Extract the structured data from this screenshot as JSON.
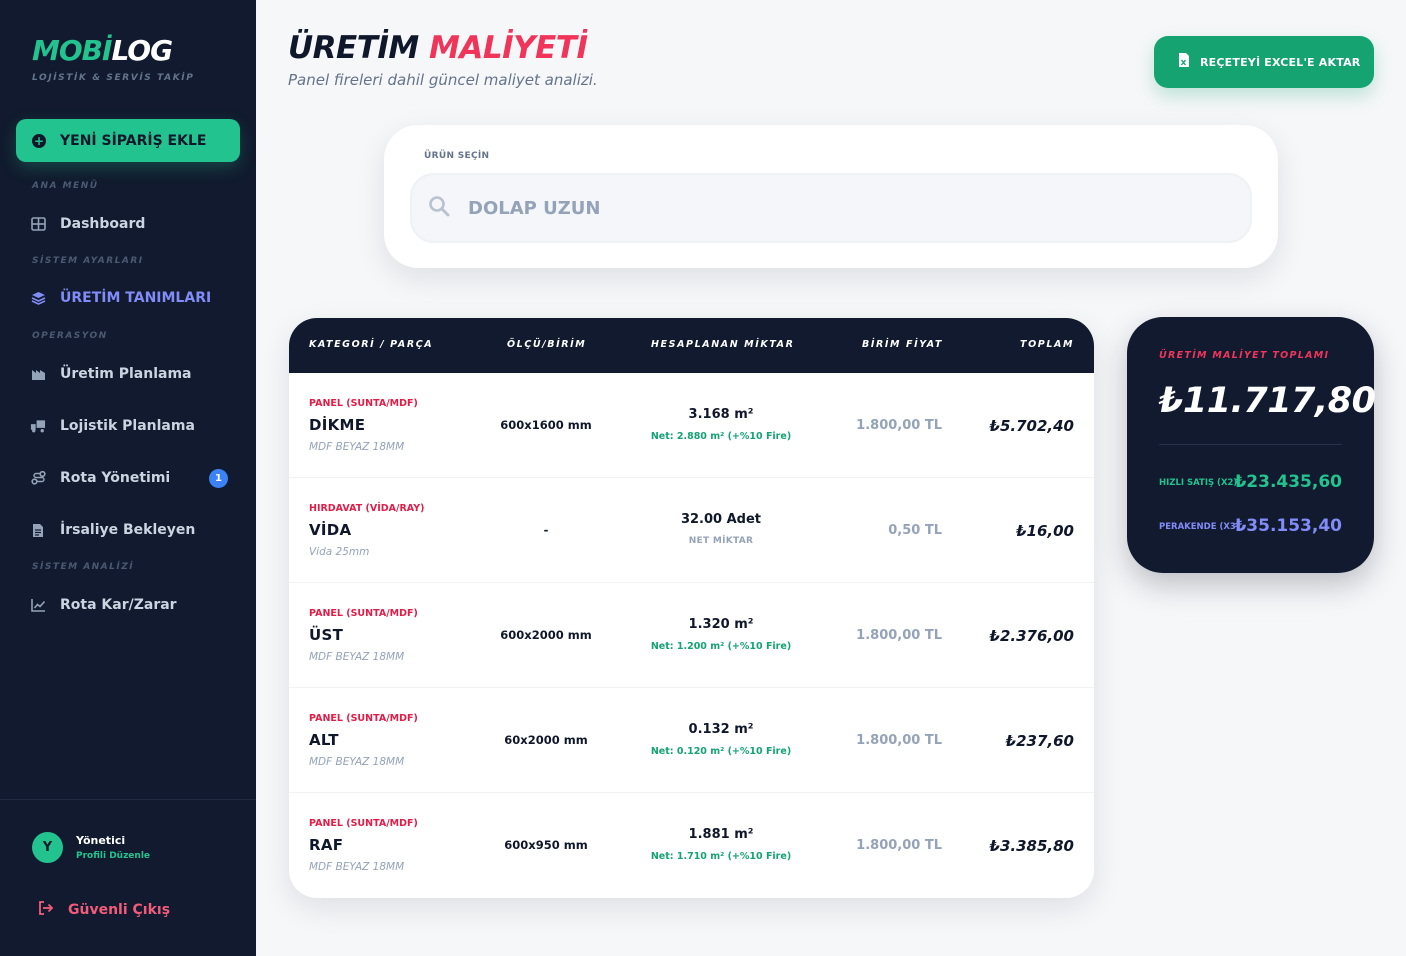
{
  "brand": {
    "part1": "MOBİ",
    "part2": "LOG",
    "tagline": "LOJİSTİK & SERVİS TAKİP"
  },
  "sidebar": {
    "new_order_label": "YENİ SİPARİŞ EKLE",
    "sections": {
      "main": "ANA MENÜ",
      "system": "SİSTEM AYARLARI",
      "ops": "OPERASYON",
      "analysis": "SİSTEM ANALİZİ"
    },
    "items": [
      {
        "label": "Dashboard",
        "icon": "grid-icon"
      },
      {
        "label": "ÜRETİM TANIMLARI",
        "icon": "layers-icon",
        "active": true
      },
      {
        "label": "Üretim Planlama",
        "icon": "factory-icon"
      },
      {
        "label": "Lojistik Planlama",
        "icon": "truck-icon"
      },
      {
        "label": "Rota Yönetimi",
        "icon": "route-icon",
        "badge": "1"
      },
      {
        "label": "İrsaliye Bekleyen",
        "icon": "document-icon"
      },
      {
        "label": "Rota Kar/Zarar",
        "icon": "chart-line-icon"
      }
    ],
    "user": {
      "initial": "Y",
      "name": "Yönetici",
      "edit_label": "Profili Düzenle"
    },
    "logout_label": "Güvenli Çıkış"
  },
  "header": {
    "title_part1": "ÜRETİM",
    "title_part2": "MALİYETİ",
    "subtitle": "Panel fireleri dahil güncel maliyet analizi.",
    "export_label": "REÇETEYİ EXCEL'E AKTAR"
  },
  "search": {
    "label": "ÜRÜN SEÇİN",
    "value": "DOLAP UZUN"
  },
  "table": {
    "headers": [
      "KATEGORİ / PARÇA",
      "ÖLÇÜ/BİRİM",
      "HESAPLANAN MİKTAR",
      "BİRİM FİYAT",
      "TOPLAM"
    ],
    "rows": [
      {
        "category": "PANEL (SUNTA/MDF)",
        "part": "DİKME",
        "spec": "MDF BEYAZ 18MM",
        "size": "600x1600 mm",
        "qty": "3.168 m²",
        "note": "Net: 2.880 m² (+%10 Fire)",
        "price": "1.800,00 TL",
        "total": "₺5.702,40"
      },
      {
        "category": "HIRDAVAT (VİDA/RAY)",
        "part": "VİDA",
        "spec": "Vida 25mm",
        "size": "-",
        "qty": "32.00 Adet",
        "note": "NET MİKTAR",
        "price": "0,50 TL",
        "total": "₺16,00"
      },
      {
        "category": "PANEL (SUNTA/MDF)",
        "part": "ÜST",
        "spec": "MDF BEYAZ 18MM",
        "size": "600x2000 mm",
        "qty": "1.320 m²",
        "note": "Net: 1.200 m² (+%10 Fire)",
        "price": "1.800,00 TL",
        "total": "₺2.376,00"
      },
      {
        "category": "PANEL (SUNTA/MDF)",
        "part": "ALT",
        "spec": "MDF BEYAZ 18MM",
        "size": "60x2000 mm",
        "qty": "0.132 m²",
        "note": "Net: 0.120 m² (+%10 Fire)",
        "price": "1.800,00 TL",
        "total": "₺237,60"
      },
      {
        "category": "PANEL (SUNTA/MDF)",
        "part": "RAF",
        "spec": "MDF BEYAZ 18MM",
        "size": "600x950 mm",
        "qty": "1.881 m²",
        "note": "Net: 1.710 m² (+%10 Fire)",
        "price": "1.800,00 TL",
        "total": "₺3.385,80"
      }
    ]
  },
  "summary": {
    "label": "ÜRETİM MALİYET TOPLAMI",
    "total": "₺11.717,80",
    "fast_sale_label": "HIZLI SATIŞ (X2)",
    "fast_sale_value": "₺23.435,60",
    "retail_label": "PERAKENDE (X3)",
    "retail_value": "₺35.153,40"
  },
  "colors": {
    "accent_green": "#22c38e",
    "accent_red": "#f0355a",
    "accent_indigo": "#818cf8",
    "dark": "#111a2e",
    "badge_blue": "#3b82f6"
  }
}
